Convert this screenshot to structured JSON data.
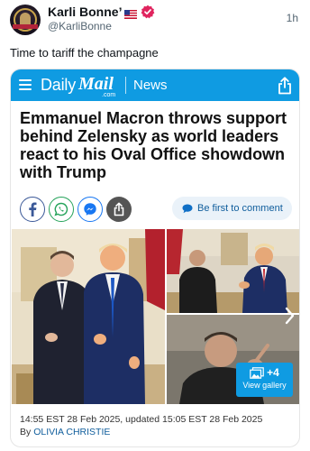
{
  "tweet": {
    "display_name": "Karli Bonne’",
    "handle": "@KarliBonne",
    "time": "1h",
    "text": "Time to tariff the champagne",
    "icons": [
      "avatar",
      "us-flag-emoji",
      "verified-badge-icon"
    ]
  },
  "card": {
    "site": {
      "logo_daily": "Daily",
      "logo_mail": "Mail",
      "logo_com": ".com",
      "section": "News",
      "icons": [
        "hamburger-menu-icon",
        "share-icon"
      ]
    },
    "headline": "Emmanuel Macron throws support behind Zelensky as world leaders react to his Oval Office showdown with Trump",
    "social_icons": [
      "facebook-icon",
      "whatsapp-icon",
      "messenger-icon",
      "more-share-icon"
    ],
    "comment_button": "Be first to comment",
    "gallery": {
      "count": "+4",
      "label": "View gallery"
    },
    "dateline": "14:55 EST 28 Feb 2025, updated 15:05 EST 28 Feb 2025",
    "byline_prefix": "By",
    "author": "OLIVIA CHRISTIE"
  },
  "colors": {
    "brand_blue": "#0f9be2",
    "verified_pink": "#e0245e",
    "author_link": "#0f5d9c"
  }
}
